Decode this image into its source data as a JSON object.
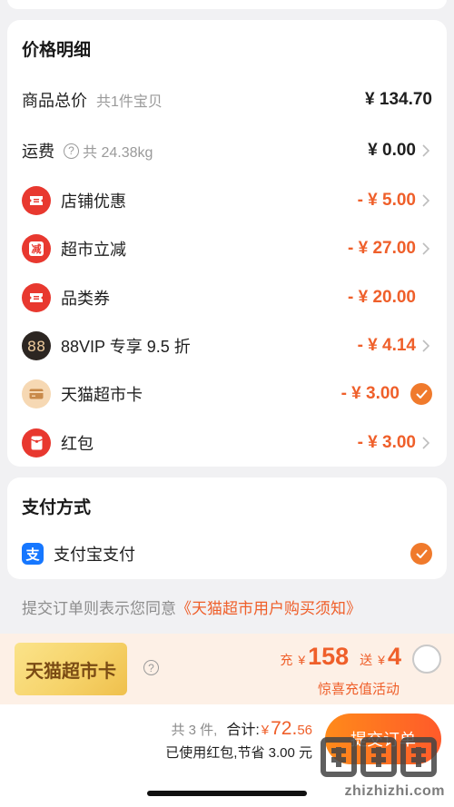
{
  "price_details": {
    "title": "价格明细",
    "rows": [
      {
        "label": "商品总价",
        "sub": "共1件宝贝",
        "amount": "¥ 134.70"
      },
      {
        "label": "运费",
        "sub": "共 24.38kg",
        "amount": "¥ 0.00"
      },
      {
        "label": "店铺优惠",
        "amount": "- ¥ 5.00",
        "icon": "coupon-ticket-icon"
      },
      {
        "label": "超市立减",
        "amount": "- ¥ 27.00",
        "icon": "instant-discount-icon",
        "icon_text": "减"
      },
      {
        "label": "品类券",
        "amount": "- ¥ 20.00",
        "icon": "coupon-ticket-icon"
      },
      {
        "label": "88VIP 专享 9.5 折",
        "amount": "- ¥ 4.14",
        "icon": "88vip-icon",
        "icon_text": "88"
      },
      {
        "label": "天猫超市卡",
        "amount": "- ¥ 3.00",
        "icon": "gift-card-icon",
        "selected": true
      },
      {
        "label": "红包",
        "amount": "- ¥ 3.00",
        "icon": "red-envelope-icon"
      }
    ]
  },
  "payment": {
    "title": "支付方式",
    "method": "支付宝支付",
    "method_icon_text": "支",
    "selected": true
  },
  "agreement": {
    "prefix": "提交订单则表示您同意",
    "link": "《天猫超市用户购买须知》"
  },
  "promo": {
    "badge": "天猫超市卡",
    "charge_label": "充",
    "charge_currency": "¥",
    "charge_amount": "158",
    "gift_label": "送",
    "gift_currency": "¥",
    "gift_amount": "4",
    "subtitle": "惊喜充值活动"
  },
  "summary": {
    "count": "共 3 件,",
    "total_label": "合计:",
    "currency": "¥",
    "total_int": "72.",
    "total_dec": "56",
    "savings": "已使用红包,节省 3.00 元",
    "submit": "提交订单"
  },
  "watermark": {
    "text": "zhizhizhi.com"
  },
  "colors": {
    "accent": "#ef5f2a",
    "icon_red": "#e8382f",
    "check_orange": "#f07a2c",
    "alipay_blue": "#1677ff"
  }
}
